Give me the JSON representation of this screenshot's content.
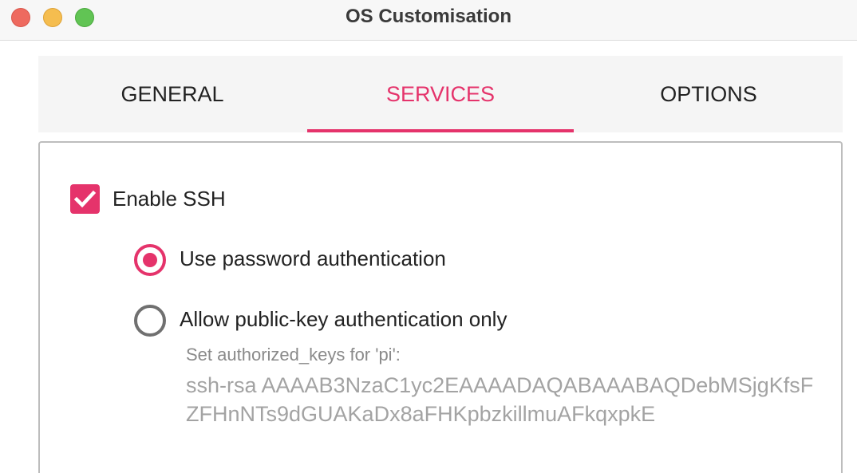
{
  "window": {
    "title": "OS Customisation",
    "colors": {
      "close": "#ee6a5f",
      "minimize": "#f5bd4f",
      "maximize": "#61c454"
    }
  },
  "tabs": [
    {
      "label": "GENERAL",
      "active": false
    },
    {
      "label": "SERVICES",
      "active": true
    },
    {
      "label": "OPTIONS",
      "active": false
    }
  ],
  "accent_color": "#e5336b",
  "services": {
    "enable_ssh": {
      "label": "Enable SSH",
      "checked": true
    },
    "auth_options": [
      {
        "label": "Use password authentication",
        "selected": true
      },
      {
        "label": "Allow public-key authentication only",
        "selected": false
      }
    ],
    "authorized_keys": {
      "label": "Set authorized_keys for 'pi':",
      "value": "ssh-rsa AAAAB3NzaC1yc2EAAAADAQABAAABAQDebMSjgKfsFZFHnNTs9dGUAKaDx8aFHKpbzkillmuAFkqxpkE"
    }
  }
}
